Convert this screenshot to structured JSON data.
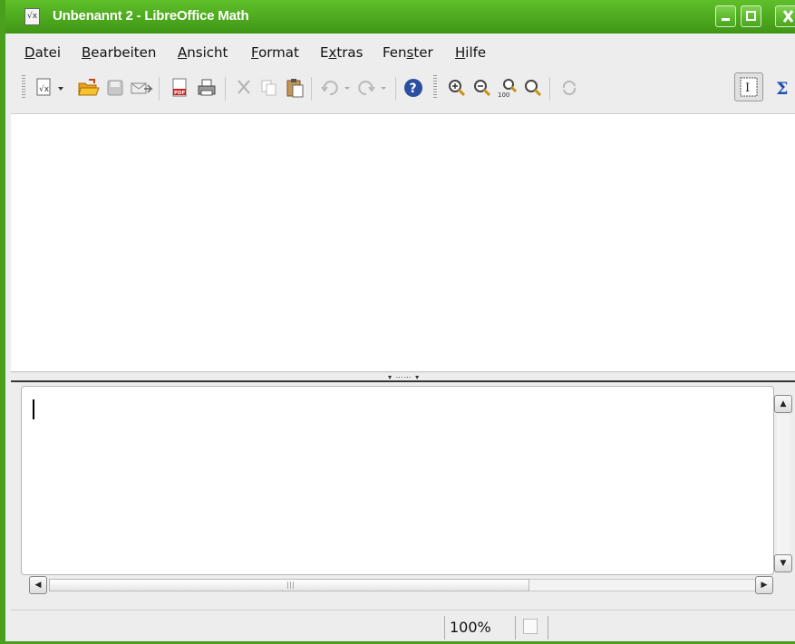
{
  "window": {
    "title": "Unbenannt 2 - LibreOffice Math",
    "app_icon": "libreoffice-math-icon",
    "accent_color": "#4aa01c"
  },
  "menubar": {
    "items": [
      {
        "label": "Datei",
        "accel": "D",
        "rest": "atei"
      },
      {
        "label": "Bearbeiten",
        "accel": "B",
        "rest": "earbeiten"
      },
      {
        "label": "Ansicht",
        "accel": "A",
        "rest": "nsicht"
      },
      {
        "label": "Format",
        "accel": "F",
        "rest": "ormat"
      },
      {
        "label": "Extras",
        "pre": "E",
        "accel": "x",
        "rest": "tras"
      },
      {
        "label": "Fenster",
        "pre": "Fen",
        "accel": "s",
        "rest": "ter"
      },
      {
        "label": "Hilfe",
        "accel": "H",
        "rest": "ilfe"
      }
    ]
  },
  "toolbar": {
    "buttons": [
      {
        "name": "new-formula-icon"
      },
      {
        "name": "open-folder-icon"
      },
      {
        "name": "save-icon"
      },
      {
        "name": "send-mail-icon"
      },
      {
        "name": "export-pdf-icon"
      },
      {
        "name": "print-icon"
      },
      {
        "name": "cut-icon"
      },
      {
        "name": "copy-icon"
      },
      {
        "name": "paste-icon"
      },
      {
        "name": "undo-icon"
      },
      {
        "name": "redo-icon"
      },
      {
        "name": "help-icon"
      },
      {
        "name": "zoom-in-icon"
      },
      {
        "name": "zoom-out-icon"
      },
      {
        "name": "zoom-100-icon"
      },
      {
        "name": "show-all-icon"
      },
      {
        "name": "update-icon"
      },
      {
        "name": "formula-cursor-icon"
      },
      {
        "name": "symbols-icon"
      }
    ],
    "zoom_100_label": "100"
  },
  "editor": {
    "content": ""
  },
  "statusbar": {
    "zoom": "100%"
  }
}
